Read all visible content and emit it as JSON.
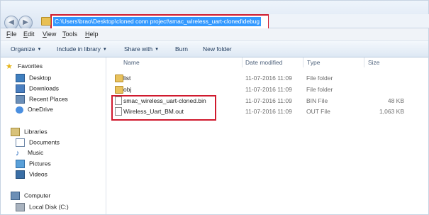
{
  "address": {
    "path": "C:\\Users\\brao\\Desktop\\cloned conn project\\smac_wireless_uart-cloned\\debug"
  },
  "menu": [
    "File",
    "Edit",
    "View",
    "Tools",
    "Help"
  ],
  "commands": {
    "organize": "Organize",
    "include": "Include in library",
    "share": "Share with",
    "burn": "Burn",
    "new_folder": "New folder"
  },
  "nav": {
    "favorites": "Favorites",
    "desktop": "Desktop",
    "downloads": "Downloads",
    "recent": "Recent Places",
    "onedrive": "OneDrive",
    "libraries": "Libraries",
    "documents": "Documents",
    "music": "Music",
    "pictures": "Pictures",
    "videos": "Videos",
    "computer": "Computer",
    "localdisk": "Local Disk (C:)"
  },
  "columns": {
    "name": "Name",
    "date": "Date modified",
    "type": "Type",
    "size": "Size"
  },
  "files": [
    {
      "name": "list",
      "date": "11-07-2016 11:09",
      "type": "File folder",
      "size": ""
    },
    {
      "name": "obj",
      "date": "11-07-2016 11:09",
      "type": "File folder",
      "size": ""
    },
    {
      "name": "smac_wireless_uart-cloned.bin",
      "date": "11-07-2016 11:09",
      "type": "BIN File",
      "size": "48 KB"
    },
    {
      "name": "Wireless_Uart_BM.out",
      "date": "11-07-2016 11:09",
      "type": "OUT File",
      "size": "1,063 KB"
    }
  ],
  "colors": {
    "highlight": "#d01a2e",
    "selection": "#3399ff"
  }
}
